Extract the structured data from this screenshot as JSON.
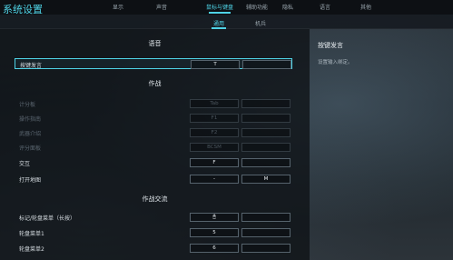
{
  "app": {
    "title": "系统设置"
  },
  "nav": {
    "tabs": [
      {
        "label": "显示",
        "active": false
      },
      {
        "label": "声音",
        "active": false
      },
      {
        "label": "鼠标与键盘",
        "active": true
      },
      {
        "label": "辅助功能",
        "active": false
      },
      {
        "label": "隐私",
        "active": false
      },
      {
        "label": "语言",
        "active": false
      },
      {
        "label": "其他",
        "active": false
      }
    ]
  },
  "subnav": {
    "tabs": [
      {
        "label": "通用",
        "active": true
      },
      {
        "label": "机兵",
        "active": false
      }
    ]
  },
  "sections": {
    "voice": {
      "title": "语音",
      "rows": [
        {
          "label": "按键发言",
          "key1": "T",
          "key2": "",
          "selected": true,
          "disabled": false
        }
      ]
    },
    "combat": {
      "title": "作战",
      "rows": [
        {
          "label": "计分板",
          "key1": "Tab",
          "key2": "",
          "disabled": true
        },
        {
          "label": "操作指南",
          "key1": "F1",
          "key2": "",
          "disabled": true
        },
        {
          "label": "武器介绍",
          "key1": "F2",
          "key2": "",
          "disabled": true
        },
        {
          "label": "评分面板",
          "key1": "BCSM",
          "key2": "",
          "disabled": true
        },
        {
          "label": "交互",
          "key1": "F",
          "key2": "",
          "disabled": false
        },
        {
          "label": "打开地图",
          "key1": "-",
          "key2": "M",
          "disabled": false
        }
      ]
    },
    "combat_comm": {
      "title": "作战交流",
      "rows": [
        {
          "label": "标记/轮盘菜单（长按）",
          "key1": "🖱",
          "key2": "",
          "disabled": false
        },
        {
          "label": "轮盘菜单1",
          "key1": "5",
          "key2": "",
          "disabled": false
        },
        {
          "label": "轮盘菜单2",
          "key1": "6",
          "key2": "",
          "disabled": false
        }
      ]
    }
  },
  "info": {
    "title": "按键发言",
    "description": "设置输入绑定。"
  },
  "colors": {
    "accent": "#4fd3e6"
  }
}
